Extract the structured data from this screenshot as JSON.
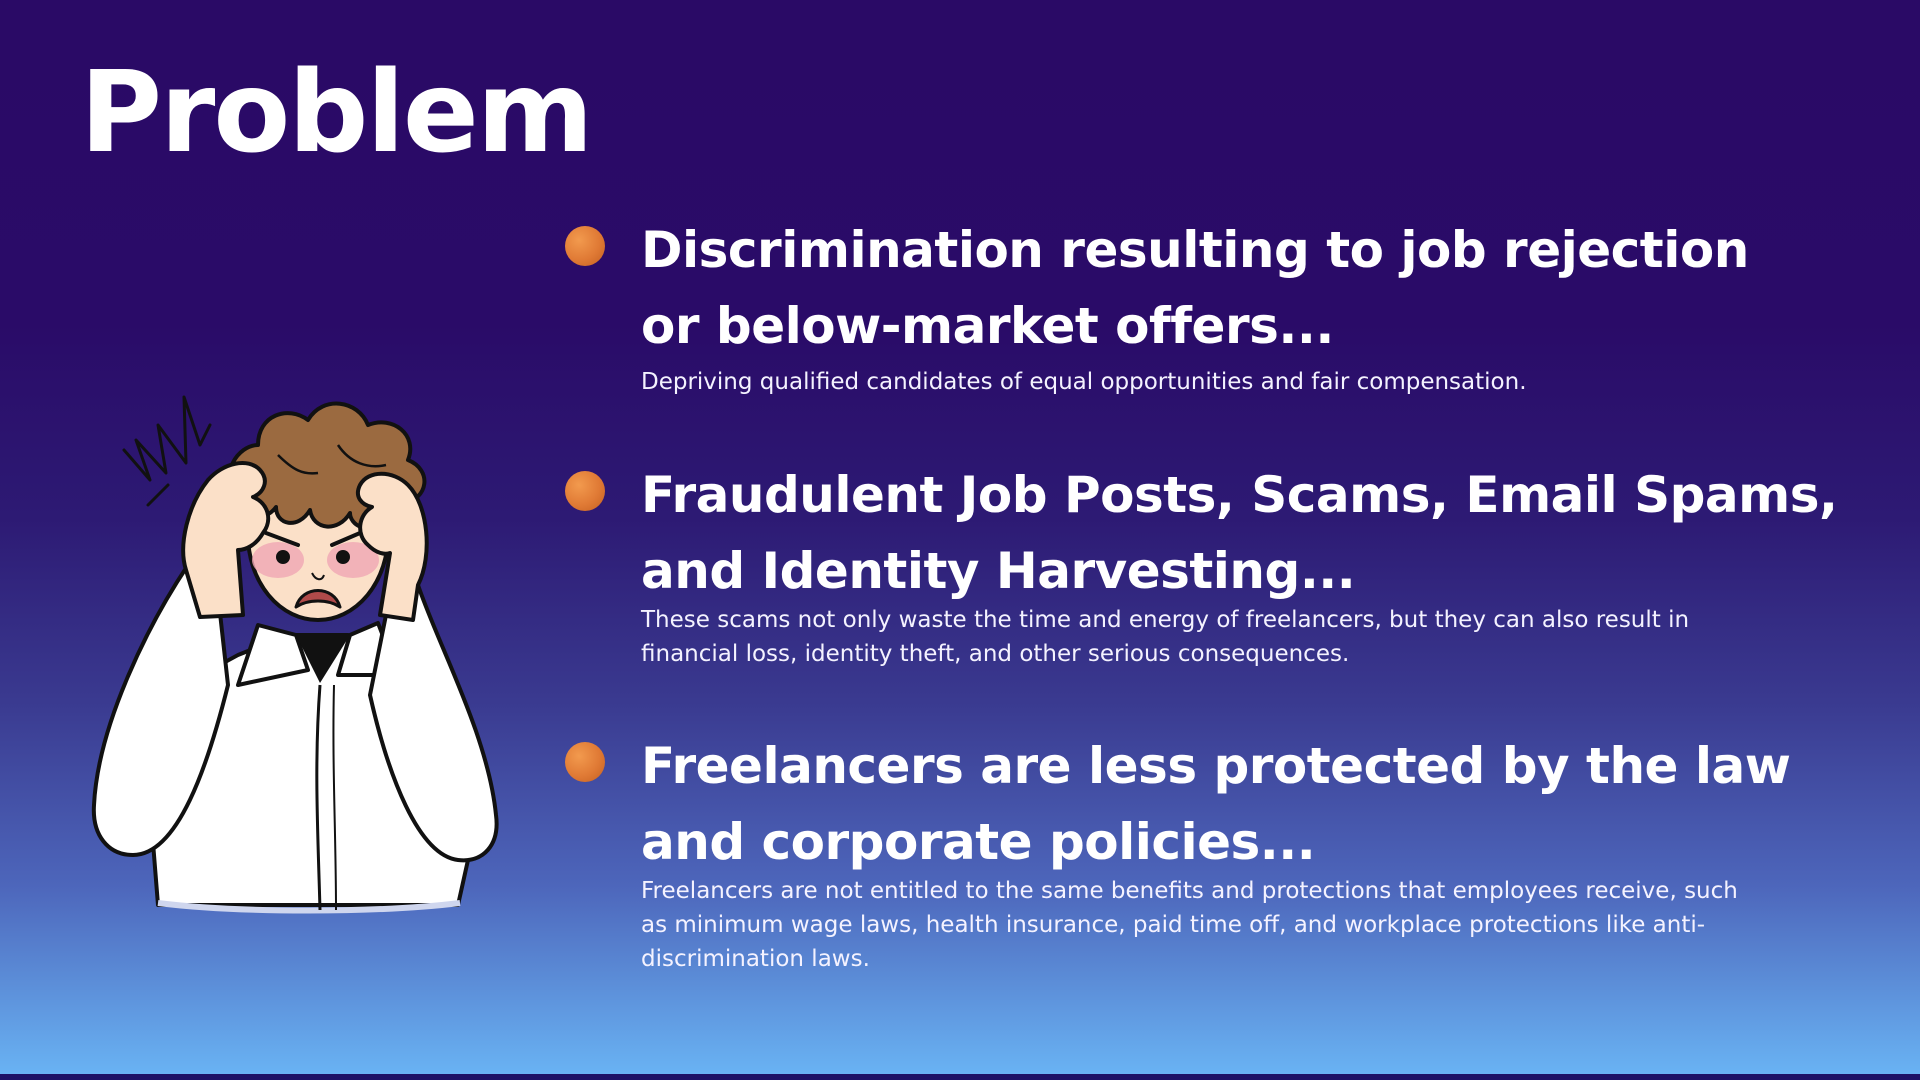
{
  "slide": {
    "title": "Problem",
    "illustration": {
      "icon": "stressed-man-holding-head-icon"
    },
    "bullet_color": "#e07a35",
    "points": [
      {
        "heading_line1": "Discrimination resulting to job rejection",
        "heading_line2": "or below-market offers...",
        "description": "Depriving qualified candidates of equal opportunities and fair compensation."
      },
      {
        "heading_line1": "Fraudulent Job Posts, Scams, Email Spams,",
        "heading_line2": "and Identity Harvesting...",
        "description": "These scams not only waste the time and energy of freelancers, but they can also result in financial loss, identity theft, and other serious consequences."
      },
      {
        "heading_line1": "Freelancers are less protected by the law",
        "heading_line2": "and corporate policies...",
        "description": "Freelancers are not entitled to the same benefits and protections that employees receive, such as minimum wage laws, health insurance, paid time off, and workplace protections like anti-discrimination laws."
      }
    ]
  }
}
